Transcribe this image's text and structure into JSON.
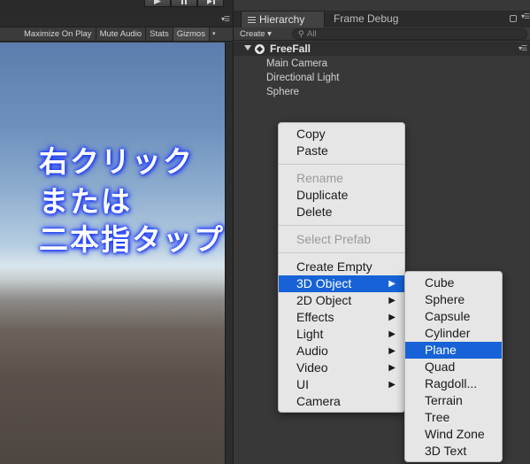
{
  "toolbar": {
    "play": "▶",
    "pause": "❚❚",
    "step": "▶❘"
  },
  "game_toolbar": {
    "maximize": "Maximize On Play",
    "mute": "Mute Audio",
    "stats": "Stats",
    "gizmos": "Gizmos"
  },
  "overlay_text": {
    "line1": "右クリック",
    "line2": "または",
    "line3": "二本指タップ"
  },
  "hierarchy": {
    "tab_label": "Hierarchy",
    "frame_debug_tab": "Frame Debug",
    "create_label": "Create",
    "search_placeholder": "All",
    "scene_name": "FreeFall",
    "items": [
      "Main Camera",
      "Directional Light",
      "Sphere"
    ]
  },
  "context_menu": {
    "items": [
      "Copy",
      "Paste",
      "Rename",
      "Duplicate",
      "Delete",
      "Select Prefab",
      "Create Empty",
      "3D Object",
      "2D Object",
      "Effects",
      "Light",
      "Audio",
      "Video",
      "UI",
      "Camera"
    ],
    "selected": "3D Object",
    "disabled": [
      "Rename",
      "Select Prefab"
    ]
  },
  "submenu_3d": {
    "items": [
      "Cube",
      "Sphere",
      "Capsule",
      "Cylinder",
      "Plane",
      "Quad",
      "Ragdoll...",
      "Terrain",
      "Tree",
      "Wind Zone",
      "3D Text"
    ],
    "selected": "Plane"
  },
  "colors": {
    "highlight": "#1762d6",
    "menu_bg": "#e6e6e6",
    "overlay_glow": "#2a48ff"
  }
}
